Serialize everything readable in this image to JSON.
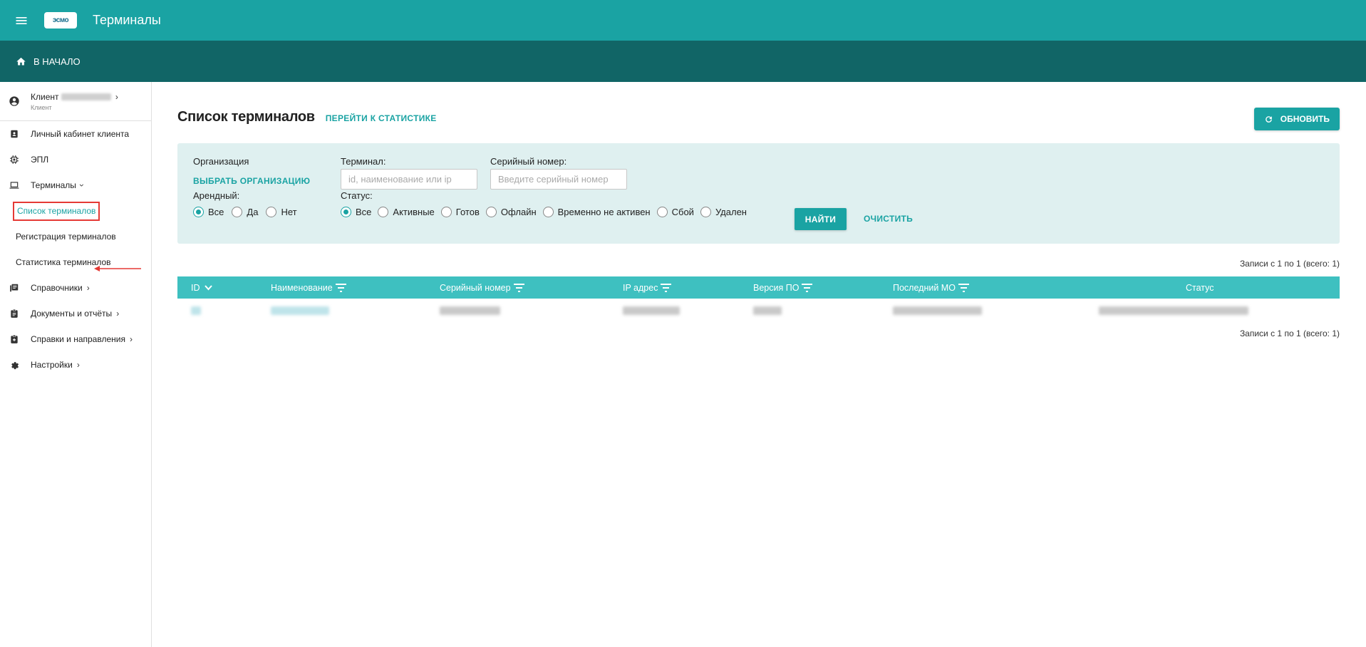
{
  "appbar": {
    "title": "Терминалы",
    "logo_text": "эсмо"
  },
  "breadcrumb": {
    "home_label": "В НАЧАЛО"
  },
  "sidebar": {
    "client": {
      "label": "Клиент",
      "subtitle": "Клиент"
    },
    "items": [
      {
        "label": "Личный кабинет клиента",
        "icon": "contact-card-icon"
      },
      {
        "label": "ЭПЛ",
        "icon": "chip-icon"
      },
      {
        "label": "Терминалы",
        "icon": "laptop-icon",
        "expanded": true
      },
      {
        "label": "Справочники",
        "icon": "books-icon"
      },
      {
        "label": "Документы и отчёты",
        "icon": "clipboard-icon"
      },
      {
        "label": "Справки и направления",
        "icon": "medical-clipboard-icon"
      },
      {
        "label": "Настройки",
        "icon": "gear-icon"
      }
    ],
    "terminals_sub": [
      {
        "label": "Список терминалов",
        "active": true
      },
      {
        "label": "Регистрация терминалов"
      },
      {
        "label": "Статистика терминалов"
      }
    ]
  },
  "main": {
    "title": "Список терминалов",
    "stats_link": "ПЕРЕЙТИ К СТАТИСТИКЕ",
    "refresh_label": "ОБНОВИТЬ",
    "filter": {
      "organization_label": "Организация",
      "organization_link": "ВЫБРАТЬ ОРГАНИЗАЦИЮ",
      "terminal_label": "Терминал:",
      "terminal_placeholder": "id, наименование или ip",
      "serial_label": "Серийный номер:",
      "serial_placeholder": "Введите серийный номер",
      "rental_label": "Арендный:",
      "rental_options": [
        "Все",
        "Да",
        "Нет"
      ],
      "rental_selected": "Все",
      "status_label": "Статус:",
      "status_options": [
        "Все",
        "Активные",
        "Готов",
        "Офлайн",
        "Временно не активен",
        "Сбой",
        "Удален"
      ],
      "status_selected": "Все",
      "find_label": "НАЙТИ",
      "clear_label": "ОЧИСТИТЬ"
    },
    "records_text": "Записи с 1 по 1 (всего: 1)",
    "table": {
      "columns": [
        "ID",
        "Наименование",
        "Серийный номер",
        "IP адрес",
        "Версия ПО",
        "Последний МО",
        "Статус"
      ]
    }
  },
  "colors": {
    "primary": "#1aa3a3",
    "dark": "#116566",
    "table_header": "#3ec0c0",
    "filter_bg": "#dff0f0",
    "alert": "#e53935"
  }
}
